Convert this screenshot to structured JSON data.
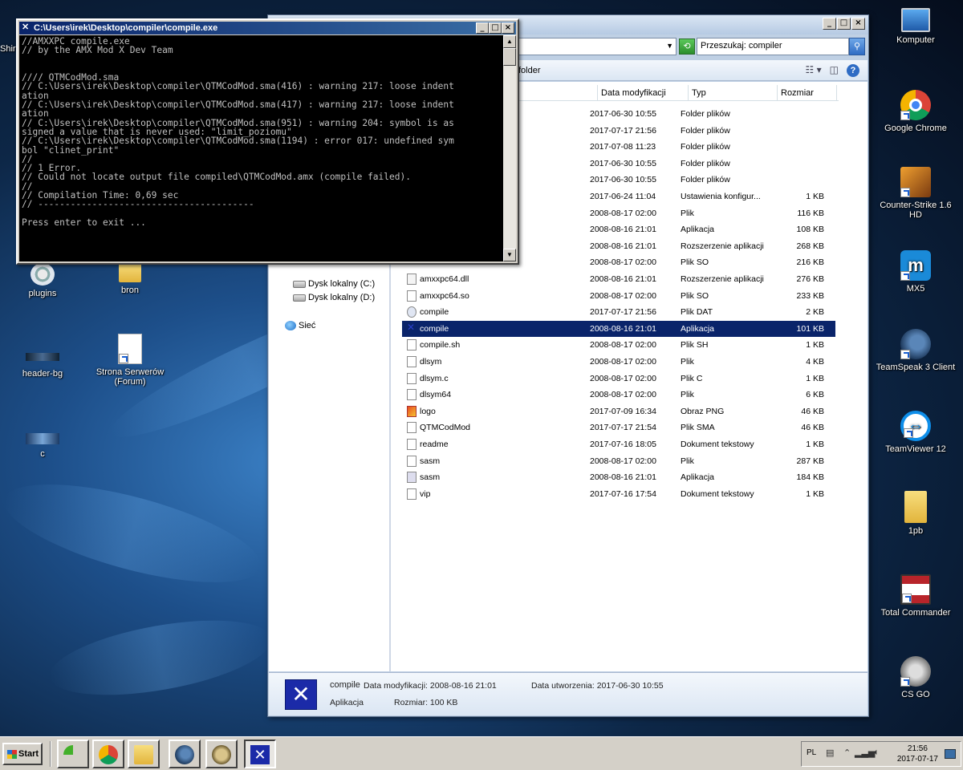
{
  "console": {
    "title": "C:\\Users\\irek\\Desktop\\compiler\\compile.exe",
    "output": "//AMXXPC compile.exe\n// by the AMX Mod X Dev Team\n\n\n//// QTMCodMod.sma\n// C:\\Users\\irek\\Desktop\\compiler\\QTMCodMod.sma(416) : warning 217: loose indent\nation\n// C:\\Users\\irek\\Desktop\\compiler\\QTMCodMod.sma(417) : warning 217: loose indent\nation\n// C:\\Users\\irek\\Desktop\\compiler\\QTMCodMod.sma(951) : warning 204: symbol is as\nsigned a value that is never used: \"limit_poziomu\"\n// C:\\Users\\irek\\Desktop\\compiler\\QTMCodMod.sma(1194) : error 017: undefined sym\nbol \"clinet_print\"\n//\n// 1 Error.\n// Could not locate output file compiled\\QTMCodMod.amx (compile failed).\n//\n// Compilation Time: 0,69 sec\n// ----------------------------------------\n\nPress enter to exit ..."
  },
  "explorer": {
    "search_placeholder": "Przeszukaj: compiler",
    "toolbar_text": "folder",
    "columns": {
      "date": "Data modyfikacji",
      "type": "Typ",
      "size": "Rozmiar"
    },
    "nav": {
      "drive_c": "Dysk lokalny (C:)",
      "drive_d": "Dysk lokalny (D:)",
      "network": "Sieć"
    },
    "files": [
      {
        "name": "",
        "date": "2017-06-30 10:55",
        "type": "Folder plików",
        "size": ""
      },
      {
        "name": "",
        "date": "2017-07-17 21:56",
        "type": "Folder plików",
        "size": ""
      },
      {
        "name": "",
        "date": "2017-07-08 11:23",
        "type": "Folder plików",
        "size": ""
      },
      {
        "name": "",
        "date": "2017-06-30 10:55",
        "type": "Folder plików",
        "size": ""
      },
      {
        "name": "",
        "date": "2017-06-30 10:55",
        "type": "Folder plików",
        "size": ""
      },
      {
        "name": "",
        "date": "2017-06-24 11:04",
        "type": "Ustawienia konfigur...",
        "size": "1 KB"
      },
      {
        "name": "",
        "date": "2008-08-17 02:00",
        "type": "Plik",
        "size": "116 KB"
      },
      {
        "name": "",
        "date": "2008-08-16 21:01",
        "type": "Aplikacja",
        "size": "108 KB"
      },
      {
        "name": "",
        "date": "2008-08-16 21:01",
        "type": "Rozszerzenie aplikacji",
        "size": "268 KB"
      },
      {
        "name": "",
        "date": "2008-08-17 02:00",
        "type": "Plik SO",
        "size": "216 KB"
      },
      {
        "name": "amxxpc64.dll",
        "date": "2008-08-16 21:01",
        "type": "Rozszerzenie aplikacji",
        "size": "276 KB"
      },
      {
        "name": "amxxpc64.so",
        "date": "2008-08-17 02:00",
        "type": "Plik SO",
        "size": "233 KB"
      },
      {
        "name": "compile",
        "date": "2017-07-17 21:56",
        "type": "Plik DAT",
        "size": "2 KB"
      },
      {
        "name": "compile",
        "date": "2008-08-16 21:01",
        "type": "Aplikacja",
        "size": "101 KB"
      },
      {
        "name": "compile.sh",
        "date": "2008-08-17 02:00",
        "type": "Plik SH",
        "size": "1 KB"
      },
      {
        "name": "dlsym",
        "date": "2008-08-17 02:00",
        "type": "Plik",
        "size": "4 KB"
      },
      {
        "name": "dlsym.c",
        "date": "2008-08-17 02:00",
        "type": "Plik C",
        "size": "1 KB"
      },
      {
        "name": "dlsym64",
        "date": "2008-08-17 02:00",
        "type": "Plik",
        "size": "6 KB"
      },
      {
        "name": "logo",
        "date": "2017-07-09 16:34",
        "type": "Obraz PNG",
        "size": "46 KB"
      },
      {
        "name": "QTMCodMod",
        "date": "2017-07-17 21:54",
        "type": "Plik SMA",
        "size": "46 KB"
      },
      {
        "name": "readme",
        "date": "2017-07-16 18:05",
        "type": "Dokument tekstowy",
        "size": "1 KB"
      },
      {
        "name": "sasm",
        "date": "2008-08-17 02:00",
        "type": "Plik",
        "size": "287 KB"
      },
      {
        "name": "sasm",
        "date": "2008-08-16 21:01",
        "type": "Aplikacja",
        "size": "184 KB"
      },
      {
        "name": "vip",
        "date": "2017-07-16 17:54",
        "type": "Dokument tekstowy",
        "size": "1 KB"
      }
    ],
    "details": {
      "name": "compile",
      "modified_label": "Data modyfikacji: 2008-08-16 21:01",
      "created_label": "Data utworzenia: 2017-06-30 10:55",
      "type": "Aplikacja",
      "size_label": "Rozmiar: 100 KB"
    }
  },
  "desktop": {
    "left_icons": [
      "plugins",
      "bron",
      "header-bg",
      "Strona Serwerów (Forum)",
      "c"
    ],
    "left_partial": "Shir",
    "right_icons": [
      "Komputer",
      "Google Chrome",
      "Counter-Strike 1.6 HD",
      "MX5",
      "TeamSpeak 3 Client",
      "TeamViewer 12",
      "1pb",
      "Total Commander",
      "CS GO"
    ]
  },
  "taskbar": {
    "start_label": "Start",
    "lang": "PL",
    "time": "21:56",
    "date": "2017-07-17"
  }
}
